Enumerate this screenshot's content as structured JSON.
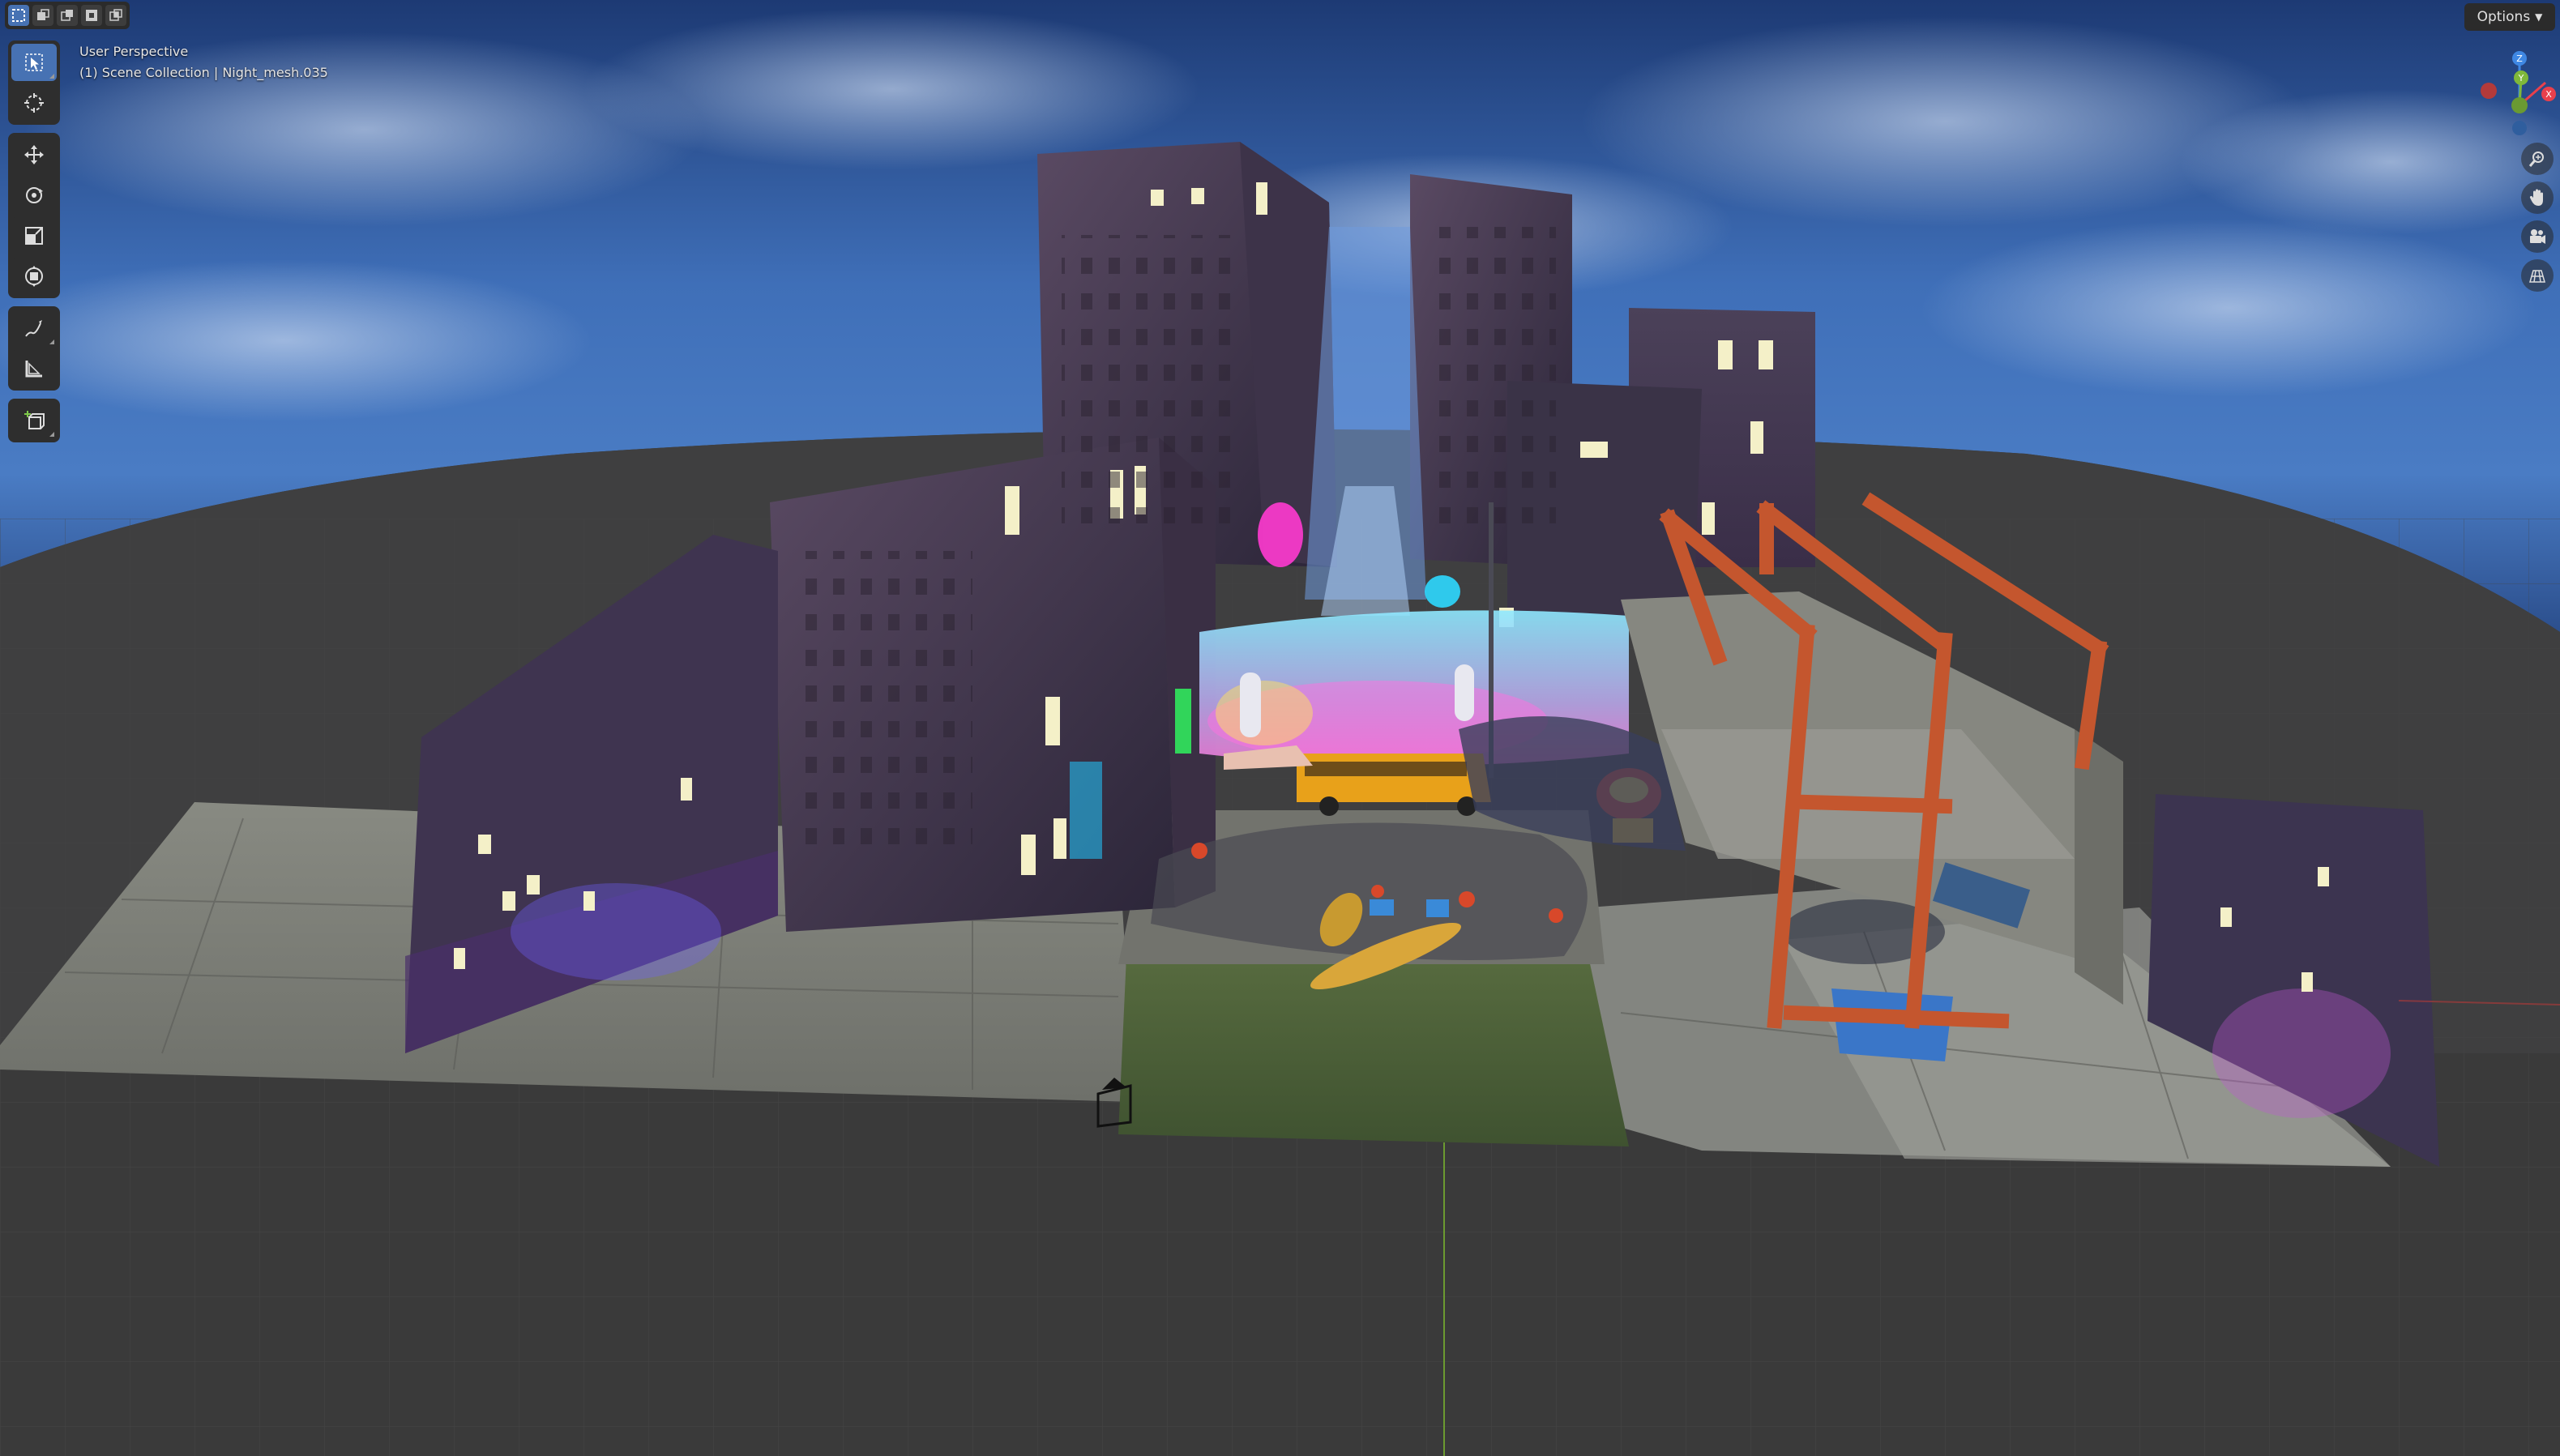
{
  "viewport": {
    "perspective_label": "User Perspective",
    "collection_label": "(1) Scene Collection | Night_mesh.035"
  },
  "header": {
    "options_label": "Options"
  },
  "mode_selector": {
    "modes": [
      "select-box-icon",
      "select-extend-icon",
      "select-subtract-icon",
      "select-invert-icon",
      "select-intersect-icon"
    ],
    "active_index": 0
  },
  "toolbar": {
    "tools": [
      {
        "name": "select-box",
        "icon": "cursor-arrow-icon",
        "active": true
      },
      {
        "name": "cursor",
        "icon": "3d-cursor-icon",
        "active": false
      },
      {
        "name": "move",
        "icon": "move-arrows-icon",
        "active": false
      },
      {
        "name": "rotate",
        "icon": "rotate-icon",
        "active": false
      },
      {
        "name": "scale",
        "icon": "scale-icon",
        "active": false
      },
      {
        "name": "transform",
        "icon": "transform-icon",
        "active": false
      },
      {
        "name": "annotate",
        "icon": "pencil-icon",
        "active": false
      },
      {
        "name": "measure",
        "icon": "ruler-icon",
        "active": false
      },
      {
        "name": "add-cube",
        "icon": "add-cube-icon",
        "active": false
      }
    ]
  },
  "gizmo": {
    "axes": [
      "Z",
      "Y",
      "X"
    ],
    "colors": {
      "x": "#e8404c",
      "y": "#7fb83a",
      "z": "#3f88e4"
    }
  },
  "navigation": {
    "buttons": [
      "zoom-icon",
      "pan-hand-icon",
      "camera-icon",
      "ortho-grid-icon"
    ]
  },
  "colors": {
    "active_tool": "#4772b3",
    "panel_bg": "#2e2e2e",
    "grid_bg": "#3a3a3a"
  }
}
